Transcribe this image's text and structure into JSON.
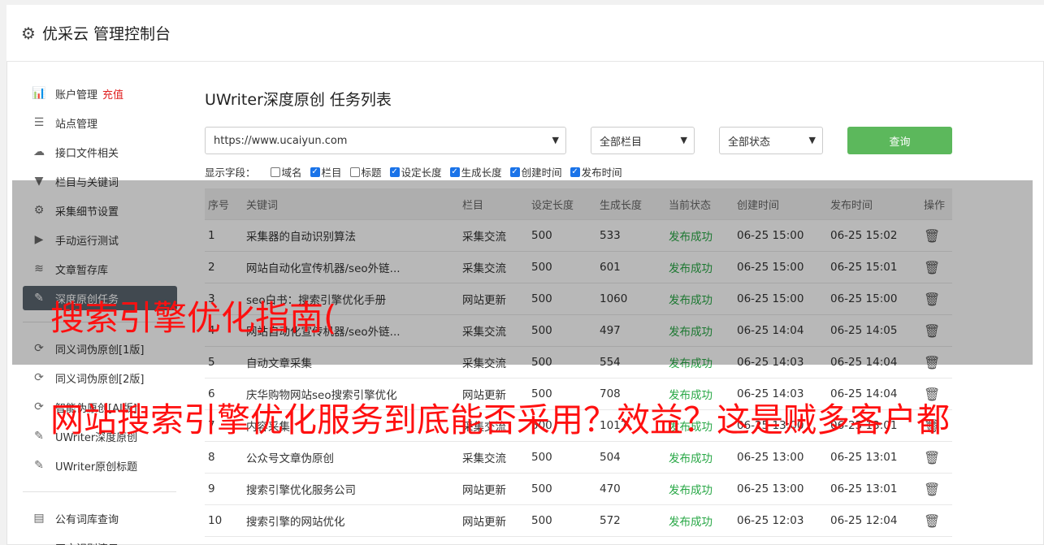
{
  "header": {
    "title": "优采云 管理控制台",
    "icon": "gear-icon"
  },
  "sidebar": {
    "group1": [
      {
        "label": "账户管理",
        "extra": "充值",
        "icon": "bar-chart-icon",
        "glyph": "📊"
      },
      {
        "label": "站点管理",
        "icon": "server-icon",
        "glyph": "☰"
      },
      {
        "label": "接口文件相关",
        "icon": "cloud-upload-icon",
        "glyph": "☁"
      },
      {
        "label": "栏目与关键词",
        "icon": "filter-icon",
        "glyph": "▼"
      },
      {
        "label": "采集细节设置",
        "icon": "gears-icon",
        "glyph": "⚙"
      },
      {
        "label": "手动运行测试",
        "icon": "play-icon",
        "glyph": "▶"
      },
      {
        "label": "文章暂存库",
        "icon": "database-icon",
        "glyph": "≋"
      },
      {
        "label": "深度原创任务",
        "icon": "edit-icon",
        "glyph": "✎",
        "active": true
      }
    ],
    "group2": [
      {
        "label": "同义词伪原创[1版]",
        "icon": "refresh-icon",
        "glyph": "⟳"
      },
      {
        "label": "同义词伪原创[2版]",
        "icon": "refresh-icon",
        "glyph": "⟳"
      },
      {
        "label": "智能伪原创[AI版]",
        "icon": "refresh-icon",
        "glyph": "⟳"
      },
      {
        "label": "UWriter深度原创",
        "icon": "edit-icon",
        "glyph": "✎"
      },
      {
        "label": "UWriter原创标题",
        "icon": "edit-icon",
        "glyph": "✎"
      }
    ],
    "group3": [
      {
        "label": "公有词库查询",
        "icon": "book-icon",
        "glyph": "▤"
      },
      {
        "label": "正文识别演示",
        "icon": "monitor-icon",
        "glyph": "▭"
      }
    ]
  },
  "main": {
    "title": "UWriter深度原创 任务列表",
    "site_select": "https://www.ucaiyun.com",
    "column_select": "全部栏目",
    "status_select": "全部状态",
    "query_label": "查询",
    "fields_label": "显示字段：",
    "fields": [
      {
        "label": "域名",
        "checked": false
      },
      {
        "label": "栏目",
        "checked": true
      },
      {
        "label": "标题",
        "checked": false
      },
      {
        "label": "设定长度",
        "checked": true
      },
      {
        "label": "生成长度",
        "checked": true
      },
      {
        "label": "创建时间",
        "checked": true
      },
      {
        "label": "发布时间",
        "checked": true
      }
    ]
  },
  "table": {
    "headers": [
      "序号",
      "关键词",
      "栏目",
      "设定长度",
      "生成长度",
      "当前状态",
      "创建时间",
      "发布时间",
      "操作"
    ],
    "rows": [
      [
        "1",
        "采集器的自动识别算法",
        "采集交流",
        "500",
        "533",
        "发布成功",
        "06-25 15:00",
        "06-25 15:02"
      ],
      [
        "2",
        "网站自动化宣传机器/seo外链...",
        "采集交流",
        "500",
        "601",
        "发布成功",
        "06-25 15:00",
        "06-25 15:01"
      ],
      [
        "3",
        "seo白书：搜索引擎优化手册",
        "网站更新",
        "500",
        "1060",
        "发布成功",
        "06-25 15:00",
        "06-25 15:00"
      ],
      [
        "4",
        "网站自动化宣传机器/seo外链...",
        "采集交流",
        "500",
        "497",
        "发布成功",
        "06-25 14:04",
        "06-25 14:05"
      ],
      [
        "5",
        "自动文章采集",
        "采集交流",
        "500",
        "554",
        "发布成功",
        "06-25 14:03",
        "06-25 14:04"
      ],
      [
        "6",
        "庆华购物网站seo搜索引擎优化",
        "网站更新",
        "500",
        "708",
        "发布成功",
        "06-25 14:03",
        "06-25 14:04"
      ],
      [
        "7",
        "内容采集",
        "采集交流",
        "500",
        "1017",
        "发布成功",
        "06-25 13:00",
        "06-25 13:01"
      ],
      [
        "8",
        "公众号文章伪原创",
        "采集交流",
        "500",
        "504",
        "发布成功",
        "06-25 13:00",
        "06-25 13:01"
      ],
      [
        "9",
        "搜索引擎优化服务公司",
        "网站更新",
        "500",
        "470",
        "发布成功",
        "06-25 13:00",
        "06-25 13:01"
      ],
      [
        "10",
        "搜索引擎的网站优化",
        "网站更新",
        "500",
        "572",
        "发布成功",
        "06-25 12:03",
        "06-25 12:04"
      ]
    ]
  },
  "overlay": {
    "line1": "搜索引擎优化指南(",
    "line2": "网站搜索引擎优化服务到底能否采用？效益？这是贼多客户都"
  },
  "colors": {
    "accent_green": "#5cb85c",
    "status_green": "#27a745",
    "overlay_red": "#ff1010",
    "recharge_red": "#e02020"
  }
}
